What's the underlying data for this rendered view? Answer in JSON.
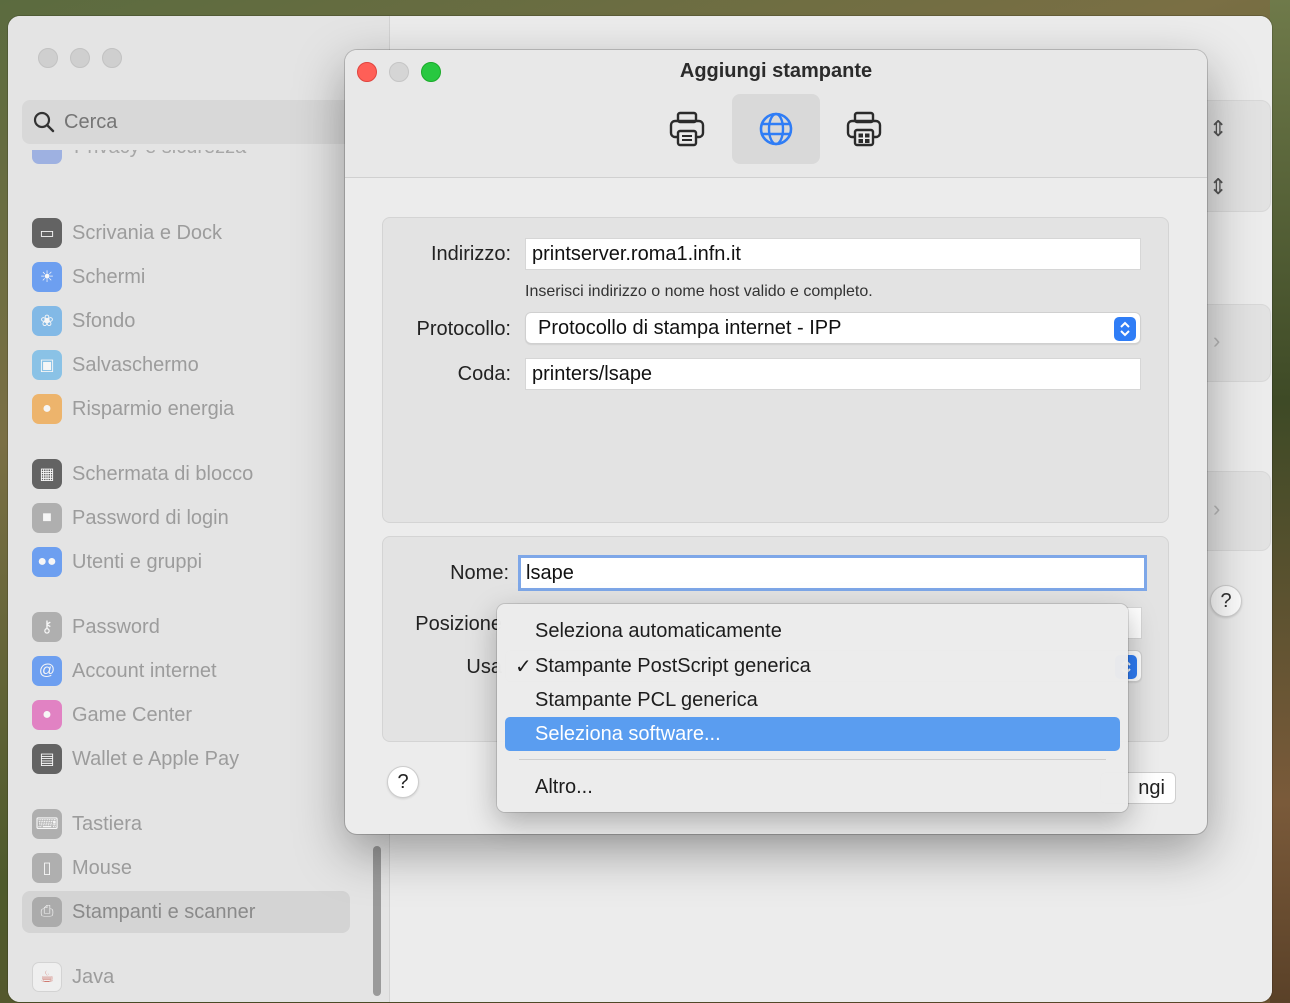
{
  "settings": {
    "search_placeholder": "Cerca",
    "cutoff_item": "Privacy e sicurezza",
    "sidebar": [
      {
        "label": "Scrivania e Dock",
        "icon": "dock-icon",
        "color": "#2d2d2d"
      },
      {
        "label": "Schermi",
        "icon": "brightness-icon",
        "color": "#3b82f6"
      },
      {
        "label": "Sfondo",
        "icon": "flower-icon",
        "color": "#5aa7e8"
      },
      {
        "label": "Salvaschermo",
        "icon": "screensaver-icon",
        "color": "#64b5e8"
      },
      {
        "label": "Risparmio energia",
        "icon": "lightbulb-icon",
        "color": "#f2a13a"
      },
      {
        "label": "Schermata di blocco",
        "icon": "lock-screen-icon",
        "color": "#2d2d2d"
      },
      {
        "label": "Password di login",
        "icon": "lock-icon",
        "color": "#9a9a9a"
      },
      {
        "label": "Utenti e gruppi",
        "icon": "users-icon",
        "color": "#3b82f6"
      },
      {
        "label": "Password",
        "icon": "key-icon",
        "color": "#9a9a9a"
      },
      {
        "label": "Account internet",
        "icon": "at-icon",
        "color": "#3b82f6"
      },
      {
        "label": "Game Center",
        "icon": "game-center-icon",
        "color": "#e05ab6"
      },
      {
        "label": "Wallet e Apple Pay",
        "icon": "wallet-icon",
        "color": "#2d2d2d"
      },
      {
        "label": "Tastiera",
        "icon": "keyboard-icon",
        "color": "#9a9a9a"
      },
      {
        "label": "Mouse",
        "icon": "mouse-icon",
        "color": "#9a9a9a"
      },
      {
        "label": "Stampanti e scanner",
        "icon": "printer-icon",
        "color": "#9a9a9a"
      },
      {
        "label": "Java",
        "icon": "java-icon",
        "color": "#f4f4f4"
      }
    ]
  },
  "dialog": {
    "title": "Aggiungi stampante",
    "toolbar": [
      "default-printer-icon",
      "ip-globe-icon",
      "windows-printer-icon"
    ],
    "selected_tab": "ip-globe-icon",
    "address_label": "Indirizzo:",
    "address_value": "printserver.roma1.infn.it",
    "address_hint": "Inserisci indirizzo o nome host valido e completo.",
    "protocol_label": "Protocollo:",
    "protocol_value": "Protocollo di stampa internet - IPP",
    "queue_label": "Coda:",
    "queue_value": "printers/lsape",
    "name_label": "Nome:",
    "name_value": "lsape",
    "location_label": "Posizione",
    "use_label": "Usa",
    "help": "?",
    "add_button_partial": "ngi"
  },
  "menu": {
    "items": [
      {
        "label": "Seleziona automaticamente",
        "checked": false,
        "highlighted": false
      },
      {
        "label": "Stampante PostScript generica",
        "checked": true,
        "highlighted": false
      },
      {
        "label": "Stampante PCL generica",
        "checked": false,
        "highlighted": false
      },
      {
        "label": "Seleziona software...",
        "checked": false,
        "highlighted": true
      }
    ],
    "other": "Altro...",
    "check_glyph": "✓"
  },
  "colors": {
    "accent": "#2f7df6",
    "highlight": "#5a9df0",
    "close": "#ff5f57",
    "zoom": "#28c840"
  }
}
